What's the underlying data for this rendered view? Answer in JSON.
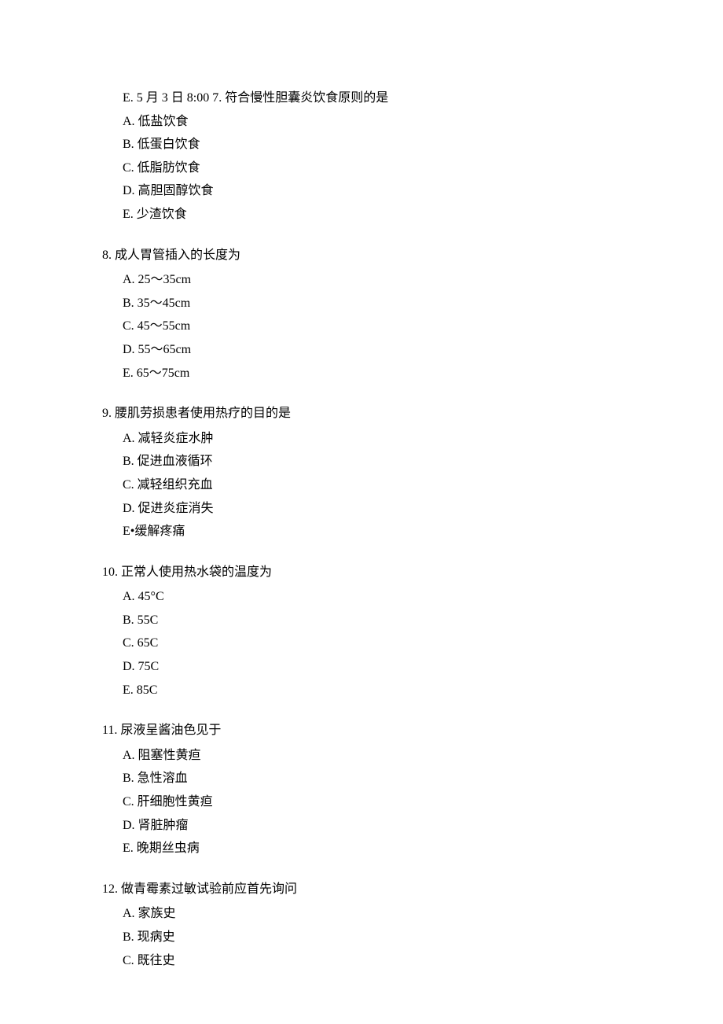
{
  "q6_7": {
    "mergedLine": "E. 5 月 3 日 8:00 7. 符合慢性胆囊炎饮食原则的是",
    "options": [
      "A. 低盐饮食",
      "B. 低蛋白饮食",
      "C. 低脂肪饮食",
      "D. 高胆固醇饮食",
      "E. 少渣饮食"
    ]
  },
  "q8": {
    "title": "8.  成人胃管插入的长度为",
    "options": [
      "A. 25〜35cm",
      "B. 35〜45cm",
      "C. 45〜55cm",
      "D. 55〜65cm",
      "E. 65〜75cm"
    ]
  },
  "q9": {
    "title": "9.  腰肌劳损患者使用热疗的目的是",
    "options": [
      "A. 减轻炎症水肿",
      "B. 促进血液循环",
      "C. 减轻组织充血",
      "D. 促进炎症消失"
    ],
    "optionE": "E•缓解疼痛"
  },
  "q10": {
    "title": "10.  正常人使用热水袋的温度为",
    "options": [
      "A. 45°C",
      "B. 55C",
      "C. 65C",
      "D. 75C",
      "E. 85C"
    ]
  },
  "q11": {
    "title": "11.  尿液呈酱油色见于",
    "options": [
      "A. 阻塞性黄疸",
      "B. 急性溶血",
      "C. 肝细胞性黄疸",
      "D. 肾脏肿瘤",
      "E. 晚期丝虫病"
    ]
  },
  "q12": {
    "title": "12.  做青霉素过敏试验前应首先询问",
    "options": [
      "A. 家族史",
      "B. 现病史",
      "C. 既往史"
    ]
  }
}
